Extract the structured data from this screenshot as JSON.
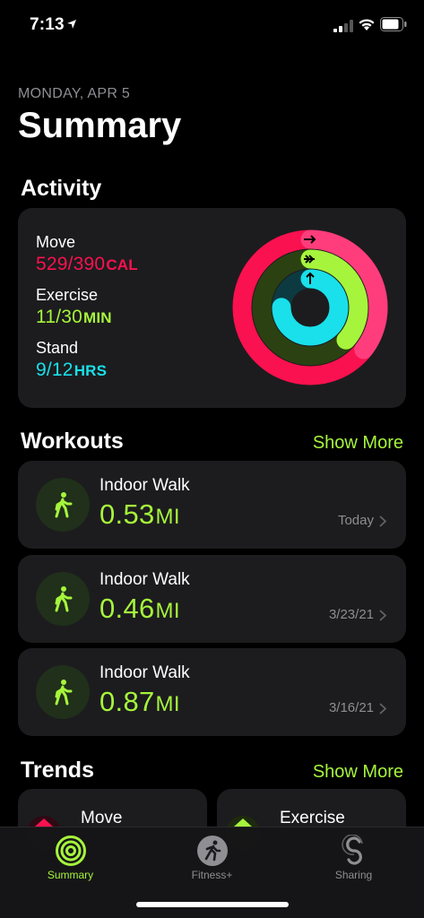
{
  "status_bar": {
    "time": "7:13"
  },
  "header": {
    "date": "MONDAY, APR 5",
    "title": "Summary"
  },
  "activity": {
    "section_title": "Activity",
    "move": {
      "label": "Move",
      "value": "529/390",
      "unit": "CAL",
      "progress": 1.356,
      "color": "#fa114f"
    },
    "exercise": {
      "label": "Exercise",
      "value": "11/30",
      "unit": "MIN",
      "progress": 0.367,
      "color": "#a6f53c"
    },
    "stand": {
      "label": "Stand",
      "value": "9/12",
      "unit": "HRS",
      "progress": 0.75,
      "color": "#19e0ea"
    }
  },
  "workouts": {
    "section_title": "Workouts",
    "show_more": "Show More",
    "items": [
      {
        "name": "Indoor Walk",
        "distance": "0.53",
        "unit": "MI",
        "date": "Today"
      },
      {
        "name": "Indoor Walk",
        "distance": "0.46",
        "unit": "MI",
        "date": "3/23/21"
      },
      {
        "name": "Indoor Walk",
        "distance": "0.87",
        "unit": "MI",
        "date": "3/16/21"
      }
    ]
  },
  "trends": {
    "section_title": "Trends",
    "show_more": "Show More",
    "items": [
      {
        "name": "Move",
        "color": "#fa114f"
      },
      {
        "name": "Exercise",
        "color": "#a6f53c"
      }
    ]
  },
  "tab_bar": {
    "tabs": [
      {
        "label": "Summary",
        "active": true
      },
      {
        "label": "Fitness+",
        "active": false
      },
      {
        "label": "Sharing",
        "active": false
      }
    ]
  }
}
